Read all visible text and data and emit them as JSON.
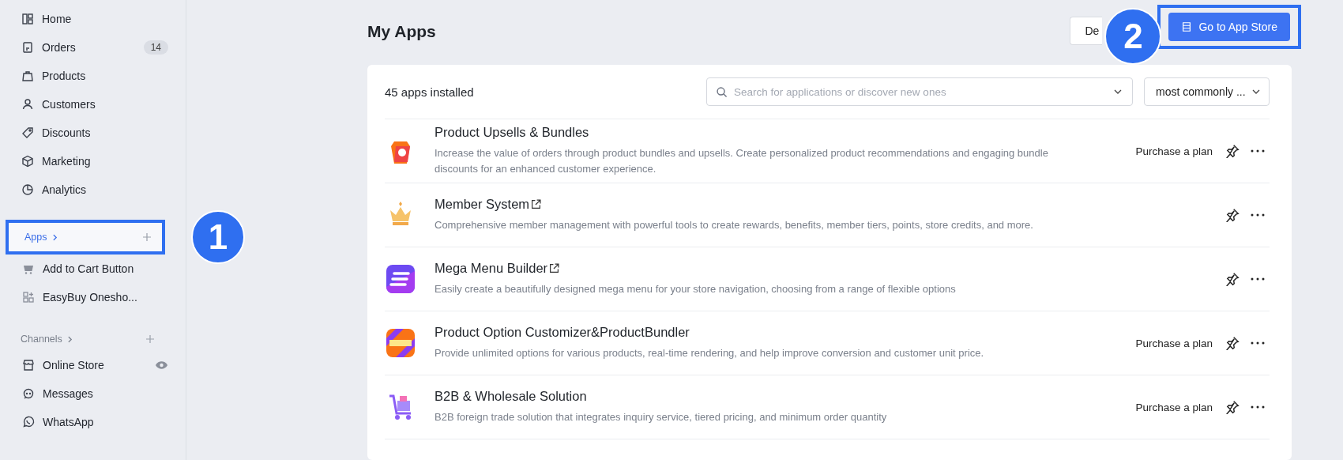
{
  "sidebar": {
    "items": [
      {
        "label": "Home",
        "selected": false
      },
      {
        "label": "Orders",
        "badge": "14",
        "selected": false
      },
      {
        "label": "Products",
        "selected": false
      },
      {
        "label": "Customers",
        "selected": false
      },
      {
        "label": "Discounts",
        "selected": false
      },
      {
        "label": "Marketing",
        "selected": false
      },
      {
        "label": "Analytics",
        "selected": false
      }
    ],
    "apps_section": {
      "label": "Apps",
      "selected": true,
      "callout": "1",
      "children": [
        {
          "label": "Add to Cart Button"
        },
        {
          "label": "EasyBuy Onesho..."
        }
      ]
    },
    "channels_section": {
      "label": "Channels",
      "selected": false,
      "children": [
        {
          "label": "Online Store",
          "preview": true
        },
        {
          "label": "Messages",
          "preview": false
        },
        {
          "label": "WhatsApp",
          "preview": false
        }
      ]
    }
  },
  "page": {
    "title": "My Apps",
    "secondary_button": "De",
    "primary_button": "Go to App Store",
    "callout": "2"
  },
  "apps_card": {
    "count": "45 apps installed",
    "search": {
      "placeholder": "Search for applications or discover new ones"
    },
    "sort": "most commonly ...",
    "apps": [
      {
        "name": "Product Upsells & Bundles",
        "external": false,
        "description": "Increase the value of orders through product bundles and upsells. Create personalized product recommendations and engaging bundle discounts for an enhanced customer experience.",
        "action": "Purchase a plan"
      },
      {
        "name": "Member System",
        "external": true,
        "description": "Comprehensive member management with powerful tools to create rewards, benefits, member tiers, points, store credits, and more."
      },
      {
        "name": "Mega Menu Builder",
        "external": true,
        "description": "Easily create a beautifully designed mega menu for your store navigation, choosing from a range of flexible options"
      },
      {
        "name": "Product Option Customizer&ProductBundler",
        "external": false,
        "description": "Provide unlimited options for various products, real-time rendering, and help improve conversion and customer unit price.",
        "action": "Purchase a plan"
      },
      {
        "name": "B2B & Wholesale Solution",
        "external": false,
        "description": "B2B foreign trade solution that integrates inquiry service, tiered pricing, and minimum order quantity",
        "action": "Purchase a plan"
      }
    ]
  }
}
